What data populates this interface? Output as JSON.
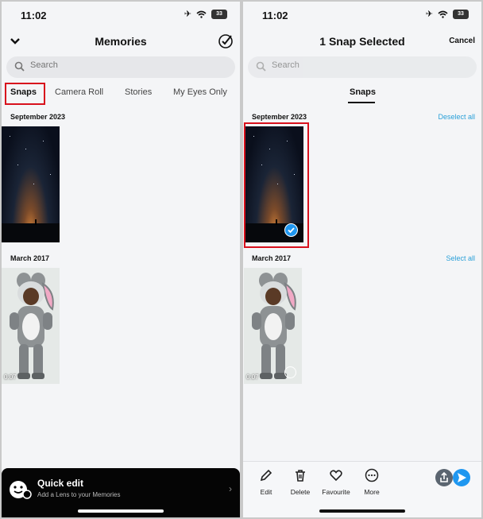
{
  "left": {
    "status": {
      "time": "11:02",
      "battery": "33"
    },
    "header": {
      "title": "Memories"
    },
    "search": {
      "placeholder": "Search"
    },
    "tabs": [
      "Snaps",
      "Camera Roll",
      "Stories",
      "My Eyes Only"
    ],
    "sections": [
      {
        "label": "September 2023"
      },
      {
        "label": "March 2017",
        "video_time": "0:07"
      }
    ],
    "quick_edit": {
      "title": "Quick edit",
      "subtitle": "Add a Lens to your Memories"
    }
  },
  "right": {
    "status": {
      "time": "11:02",
      "battery": "33"
    },
    "header": {
      "title": "1 Snap Selected",
      "cancel": "Cancel"
    },
    "search": {
      "placeholder": "Search"
    },
    "tabs": [
      "Snaps"
    ],
    "sections": [
      {
        "label": "September 2023",
        "action": "Deselect all"
      },
      {
        "label": "March 2017",
        "action": "Select all",
        "video_time": "0:07"
      }
    ],
    "toolbar": {
      "edit": "Edit",
      "delete": "Delete",
      "favourite": "Favourite",
      "more": "More"
    }
  },
  "colors": {
    "accent": "#2aa0d8",
    "selection_check": "#1f97f0",
    "highlight": "#d8101c"
  }
}
